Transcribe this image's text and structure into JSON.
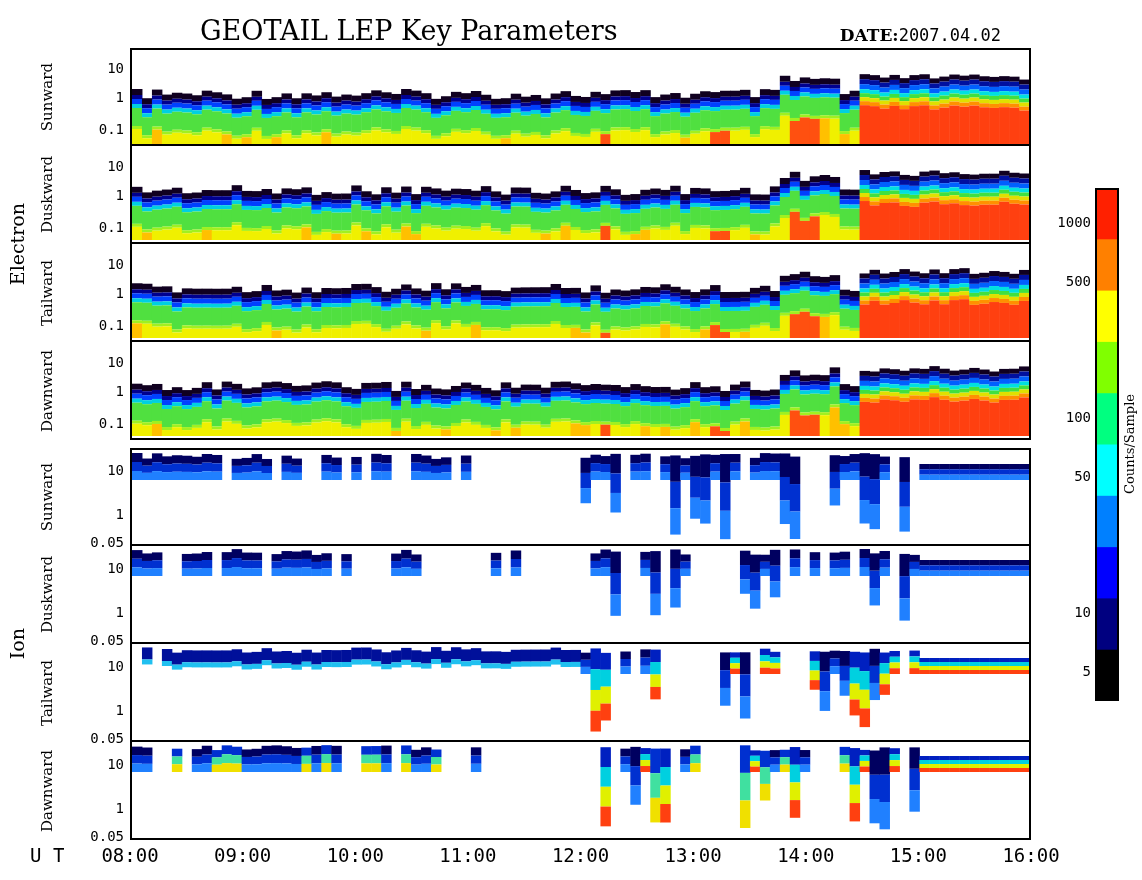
{
  "title": "GEOTAIL LEP Key Parameters",
  "date": {
    "label": "DATE:",
    "value": "2007.04.02"
  },
  "groups": [
    {
      "kind": "electron",
      "species": "Electron",
      "panels": [
        {
          "direction": "Sunward",
          "yticks": [
            "10",
            "1",
            "0.1"
          ]
        },
        {
          "direction": "Duskward",
          "yticks": [
            "10",
            "1",
            "0.1"
          ]
        },
        {
          "direction": "Tailward",
          "yticks": [
            "10",
            "1",
            "0.1"
          ]
        },
        {
          "direction": "Dawnward",
          "yticks": [
            "10",
            "1",
            "0.1"
          ]
        }
      ]
    },
    {
      "kind": "ion",
      "species": "Ion",
      "panels": [
        {
          "direction": "Sunward",
          "yticks": [
            "10",
            "1",
            "0.05"
          ]
        },
        {
          "direction": "Duskward",
          "yticks": [
            "10",
            "1",
            "0.05"
          ]
        },
        {
          "direction": "Tailward",
          "yticks": [
            "10",
            "1",
            "0.05"
          ]
        },
        {
          "direction": "Dawnward",
          "yticks": [
            "10",
            "1",
            "0.05"
          ]
        }
      ]
    }
  ],
  "time_axis": {
    "label": "U T",
    "ticks": [
      "08:00",
      "09:00",
      "10:00",
      "11:00",
      "12:00",
      "13:00",
      "14:00",
      "15:00",
      "16:00"
    ]
  },
  "colorbar": {
    "title": "Counts/Sample",
    "ticks": [
      "1000",
      "500",
      "100",
      "50",
      "10",
      "5"
    ]
  }
}
